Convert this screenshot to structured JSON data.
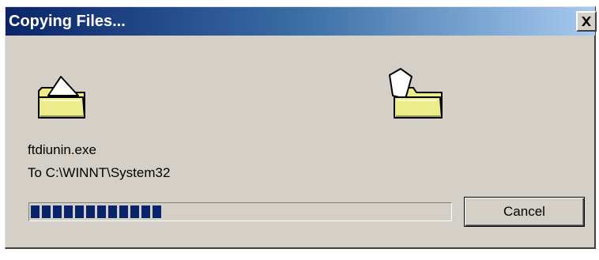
{
  "dialog": {
    "title": "Copying Files...",
    "close_icon": "close-icon",
    "file_name": "ftdiunin.exe",
    "destination": "To C:\\WINNT\\System32",
    "progress_fraction": 0.32,
    "cancel_label": "Cancel",
    "icons": {
      "source": "open-folder-icon",
      "target": "folder-with-document-icon"
    },
    "colors": {
      "title_gradient_start": "#0a246a",
      "title_gradient_end": "#a6caf0",
      "progress_block": "#0a246a",
      "face": "#d4d0c8",
      "folder": "#ecec8c"
    }
  }
}
